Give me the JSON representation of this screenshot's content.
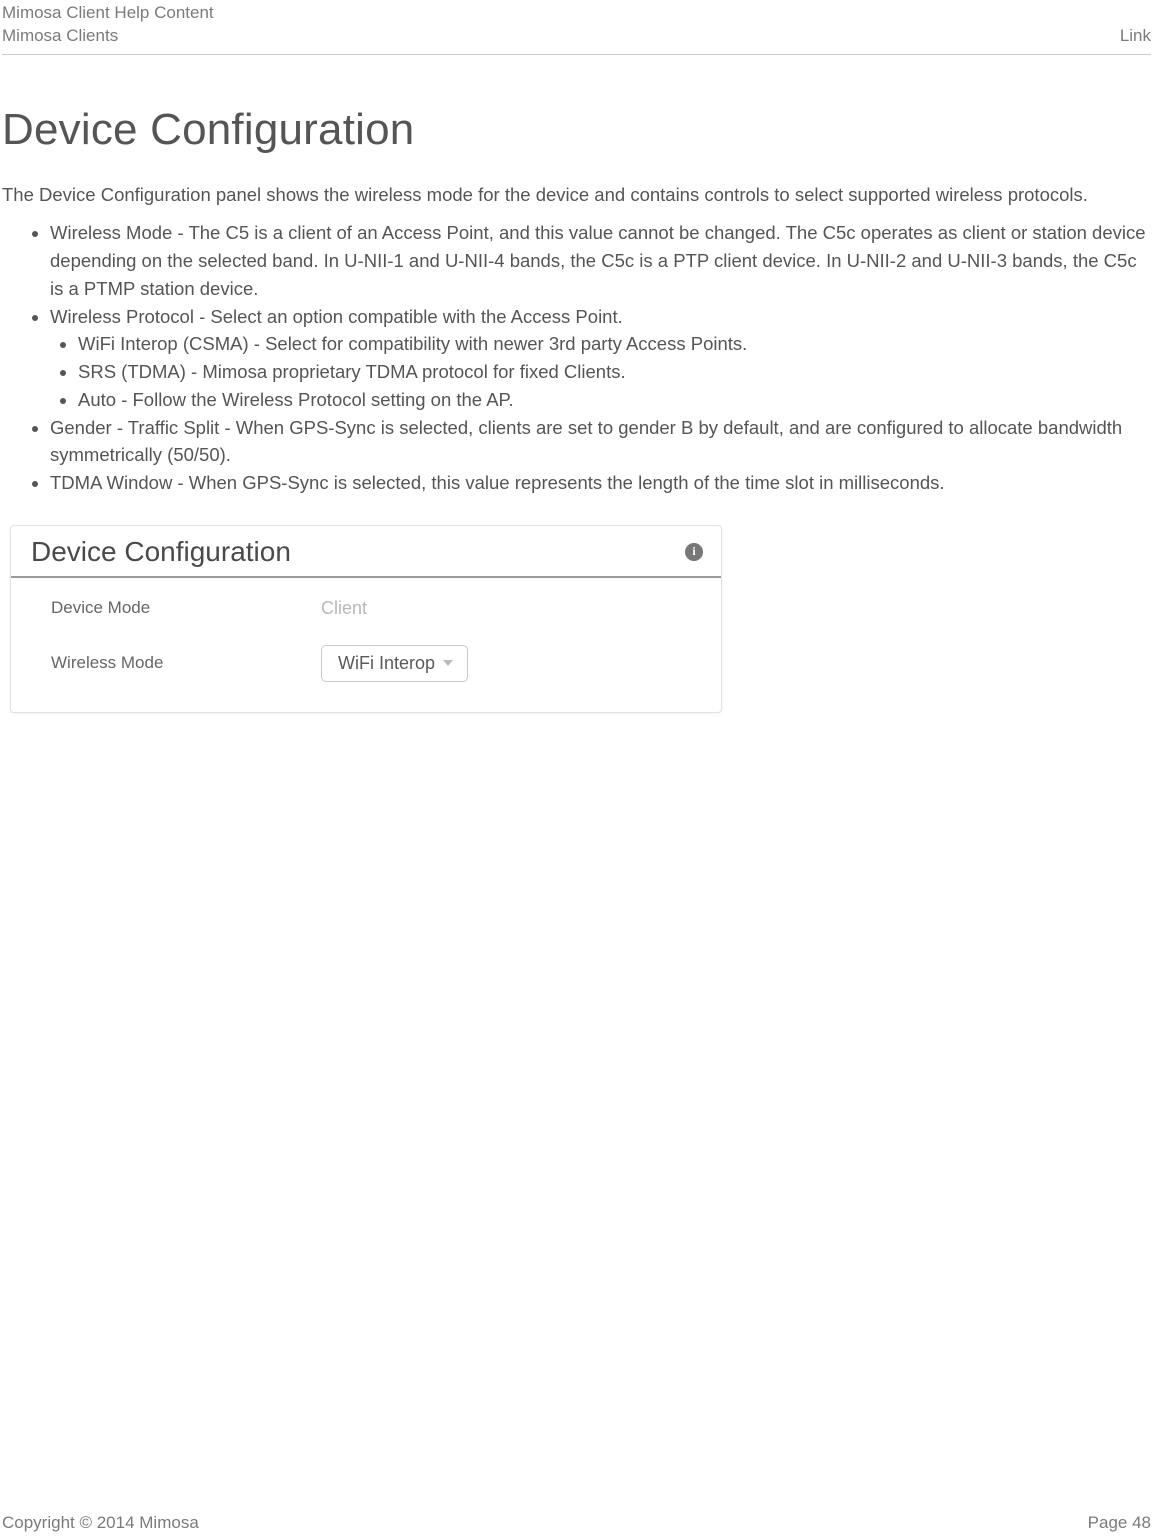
{
  "header": {
    "title_line1": "Mimosa Client Help Content",
    "title_line2": "Mimosa Clients",
    "right_label": "Link"
  },
  "page": {
    "h1": "Device Configuration",
    "intro": "The Device Configuration panel shows the wireless mode for the device and contains controls to select supported wireless protocols.",
    "bullets": {
      "b1": "Wireless Mode - The C5 is a client of an Access Point, and this value cannot be changed. The C5c operates as client or station device depending on the selected band. In U-NII-1 and U-NII-4 bands, the C5c is a PTP client device. In U-NII-2 and U-NII-3 bands, the C5c is a PTMP station device.",
      "b2": "Wireless Protocol - Select an option compatible with the Access Point.",
      "b2a": "WiFi Interop (CSMA) - Select for compatibility with newer 3rd party Access Points.",
      "b2b": "SRS (TDMA) - Mimosa proprietary TDMA protocol for fixed Clients.",
      "b2c": "Auto - Follow the Wireless Protocol setting on the AP.",
      "b3": "Gender - Traffic Split - When GPS-Sync is selected, clients are set to gender B by default, and are configured to allocate bandwidth symmetrically (50/50).",
      "b4": "TDMA Window - When GPS-Sync is selected, this value represents the length of the time slot in milliseconds."
    }
  },
  "panel": {
    "title": "Device Configuration",
    "info_glyph": "i",
    "rows": {
      "device_mode": {
        "label": "Device Mode",
        "value": "Client"
      },
      "wireless_mode": {
        "label": "Wireless Mode",
        "selected": "WiFi Interop"
      }
    }
  },
  "footer": {
    "copyright": "Copyright © 2014 Mimosa",
    "page": "Page 48"
  }
}
